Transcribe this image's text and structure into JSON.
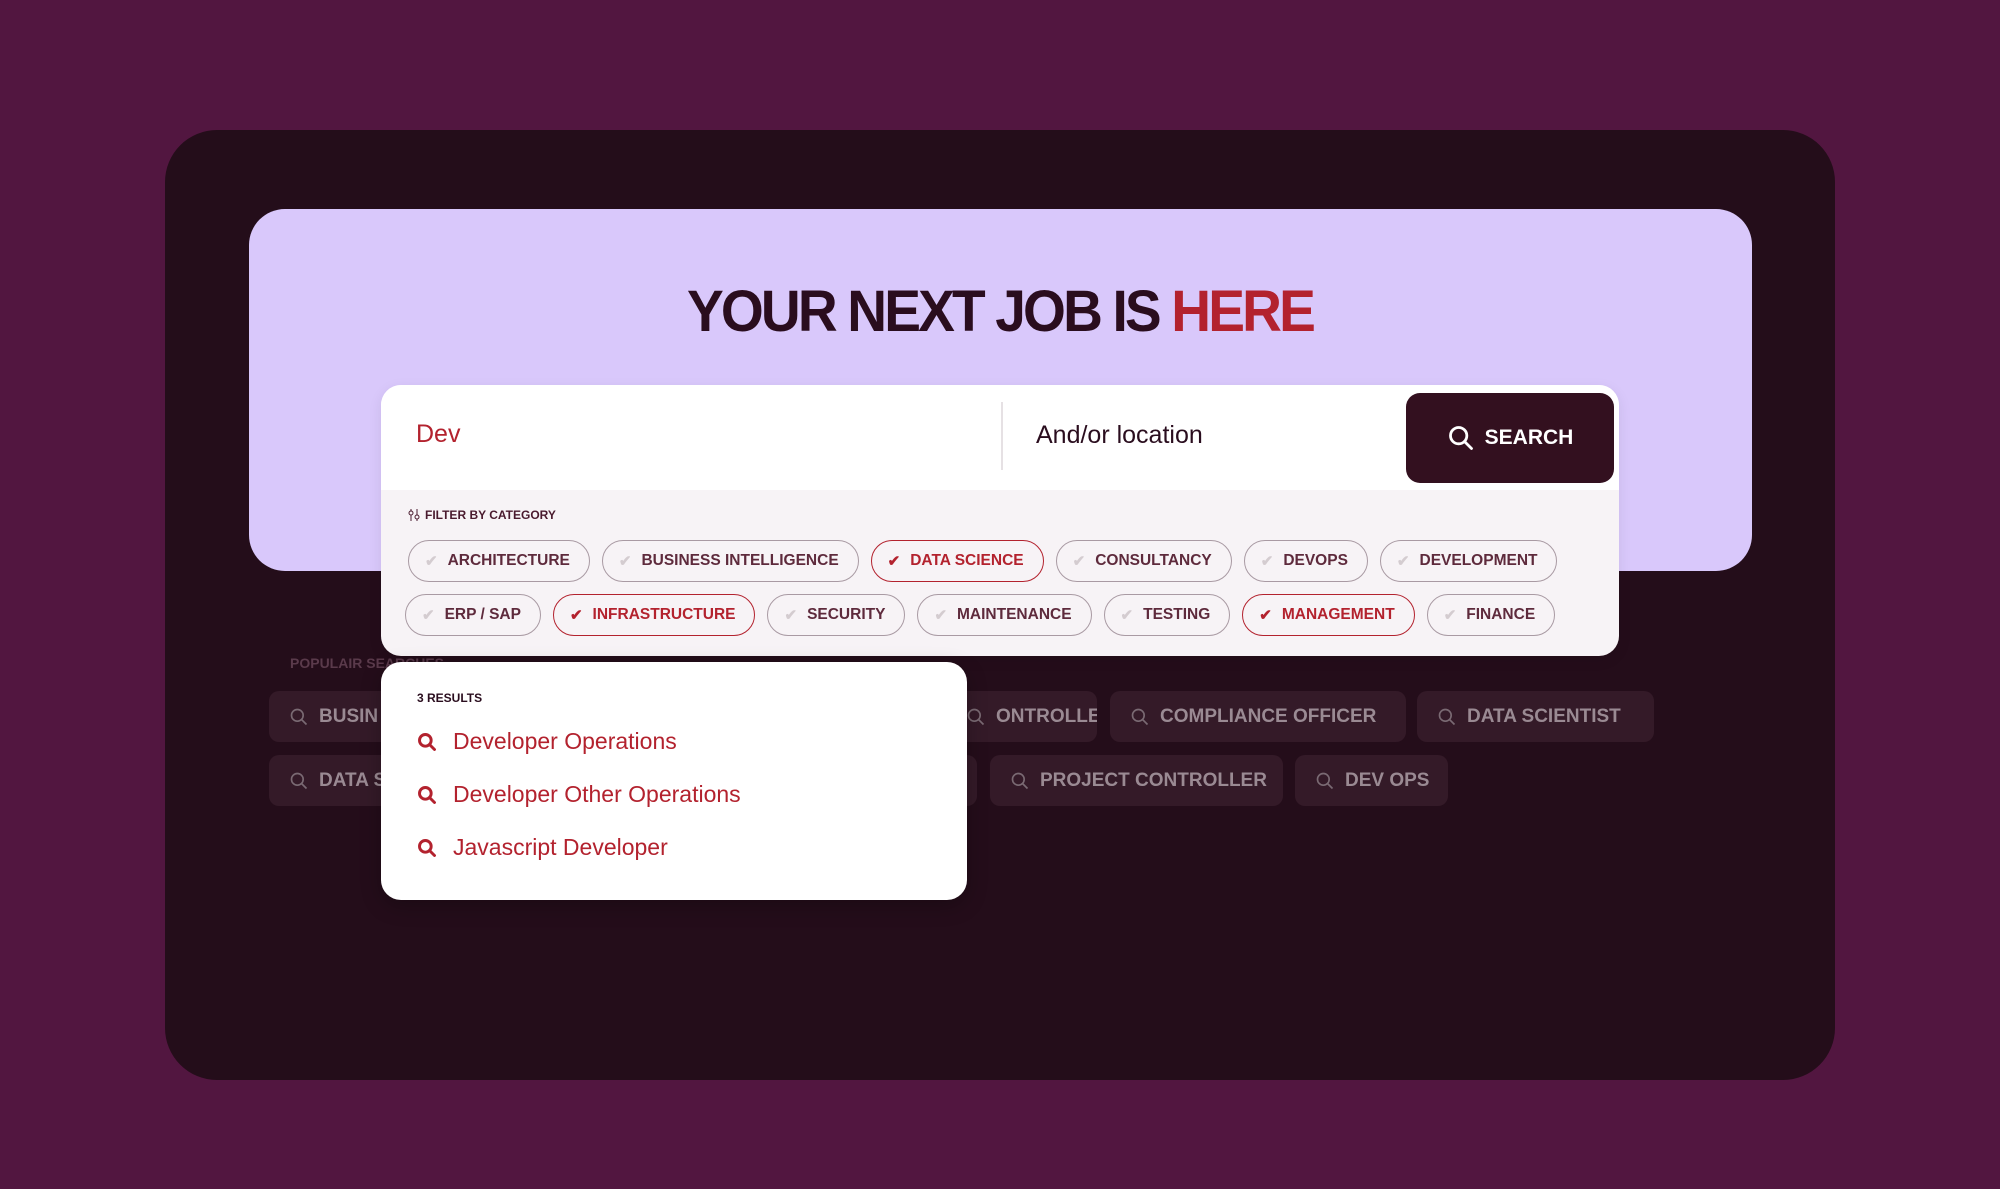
{
  "colors": {
    "background": "#521640",
    "panel": "#240d1a",
    "hero": "#d9c8fb",
    "accent": "#b3222e",
    "dark": "#33101f"
  },
  "hero": {
    "title_main": "YOUR NEXT JOB IS",
    "title_accent": "HERE"
  },
  "search": {
    "keyword_value": "Dev",
    "location_placeholder": "And/or location",
    "button_label": "SEARCH",
    "button_icon": "search-icon"
  },
  "filter": {
    "label": "FILTER BY CATEGORY",
    "icon": "sliders-icon",
    "row1": [
      {
        "label": "ARCHITECTURE",
        "selected": false
      },
      {
        "label": "BUSINESS INTELLIGENCE",
        "selected": false
      },
      {
        "label": "DATA SCIENCE",
        "selected": true
      },
      {
        "label": "CONSULTANCY",
        "selected": false
      },
      {
        "label": "DEVOPS",
        "selected": false
      },
      {
        "label": "DEVELOPMENT",
        "selected": false
      }
    ],
    "row2": [
      {
        "label": "ERP / SAP",
        "selected": false
      },
      {
        "label": "INFRASTRUCTURE",
        "selected": true
      },
      {
        "label": "SECURITY",
        "selected": false
      },
      {
        "label": "MAINTENANCE",
        "selected": false
      },
      {
        "label": "TESTING",
        "selected": false
      },
      {
        "label": "MANAGEMENT",
        "selected": true
      },
      {
        "label": "FINANCE",
        "selected": false
      }
    ]
  },
  "popular": {
    "label": "POPULAIR SEARCHES",
    "chips": [
      "BUSIN",
      "ONTROLLER",
      "COMPLIANCE OFFICER",
      "DATA SCIENTIST",
      "DATA S",
      "",
      "PROJECT CONTROLLER",
      "DEV OPS"
    ]
  },
  "results": {
    "count_label": "3 RESULTS",
    "items": [
      "Developer Operations",
      "Developer Other Operations",
      "Javascript Developer"
    ]
  }
}
